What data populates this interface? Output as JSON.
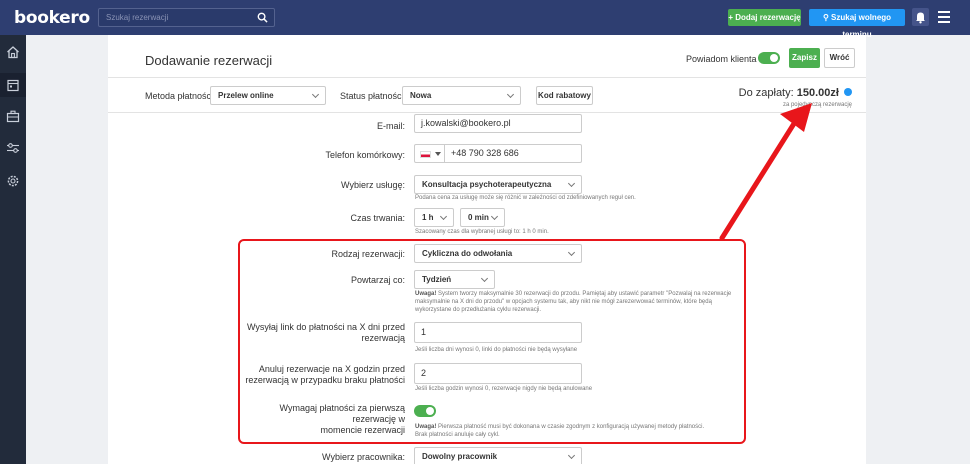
{
  "topbar": {
    "logo": "bookero",
    "search_placeholder": "Szukaj rezerwacji",
    "add_reservation": "+ Dodaj rezerwację",
    "find_slot": "Szukaj wolnego terminu"
  },
  "header": {
    "title": "Dodawanie rezerwacji",
    "notify_label": "Powiadom klienta",
    "save": "Zapisz",
    "back": "Wróć"
  },
  "payment": {
    "method_label": "Metoda płatności:",
    "method_value": "Przelew online",
    "status_label": "Status płatności:",
    "status_value": "Nowa",
    "code_button": "Kod rabatowy",
    "to_pay_label": "Do zapłaty:",
    "to_pay_value": "150.00zł",
    "to_pay_sub": "za pojedynczą rezerwację"
  },
  "form": {
    "email_label": "E-mail:",
    "email_value": "j.kowalski@bookero.pl",
    "phone_label": "Telefon komórkowy:",
    "phone_value": "+48 790 328 686",
    "service_label": "Wybierz usługę:",
    "service_value": "Konsultacja psychoterapeutyczna",
    "service_help": "Podana cena za usługę może się różnić w zależności od zdefiniowanych reguł cen.",
    "duration_label": "Czas trwania:",
    "duration_hours": "1 h",
    "duration_minutes": "0 min",
    "duration_help": "Szacowany czas dla wybranej usługi to: 1 h 0 min.",
    "type_label": "Rodzaj rezerwacji:",
    "type_value": "Cykliczna do odwołania",
    "repeat_label": "Powtarzaj co:",
    "repeat_value": "Tydzień",
    "repeat_help_bold": "Uwaga!",
    "repeat_help_1": " System tworzy maksymalnie 30 rezerwacji do przodu. Pamiętaj aby ustawić parametr \"Pozwalaj na rezerwacje",
    "repeat_help_2": "maksymalnie na X dni do przodu\" w opcjach systemu tak, aby nikt nie mógł zarezerwować terminów, które będą",
    "repeat_help_3": "wykorzystane do przedłużania cyklu rezerwacji.",
    "link_label_1": "Wysyłaj link do płatności na X dni przed",
    "link_label_2": "rezerwacją",
    "link_value": "1",
    "link_help": "Jeśli liczba dni wynosi 0, linki do płatności nie będą wysyłane",
    "cancel_label_1": "Anuluj rezerwacje na X godzin przed",
    "cancel_label_2": "rezerwacją w przypadku braku płatności",
    "cancel_value": "2",
    "cancel_help": "Jeśli liczba godzin wynosi 0, rezerwacje nigdy nie będą anulowane",
    "require_label_1": "Wymagaj płatności za pierwszą rezerwację w",
    "require_label_2": "momencie rezerwacji",
    "require_help_bold": "Uwaga!",
    "require_help_1": " Pierwsza płatność musi być dokonana w czasie zgodnym z konfiguracją używanej metody płatności.",
    "require_help_2": "Brak płatności anuluje cały cykl.",
    "worker_label": "Wybierz pracownika:",
    "worker_value": "Dowolny pracownik"
  },
  "colors": {
    "topbar": "#2e3e71",
    "sidebar": "#222b3b",
    "green": "#4caf50",
    "blue": "#2196f3",
    "highlight": "#e8161b"
  }
}
